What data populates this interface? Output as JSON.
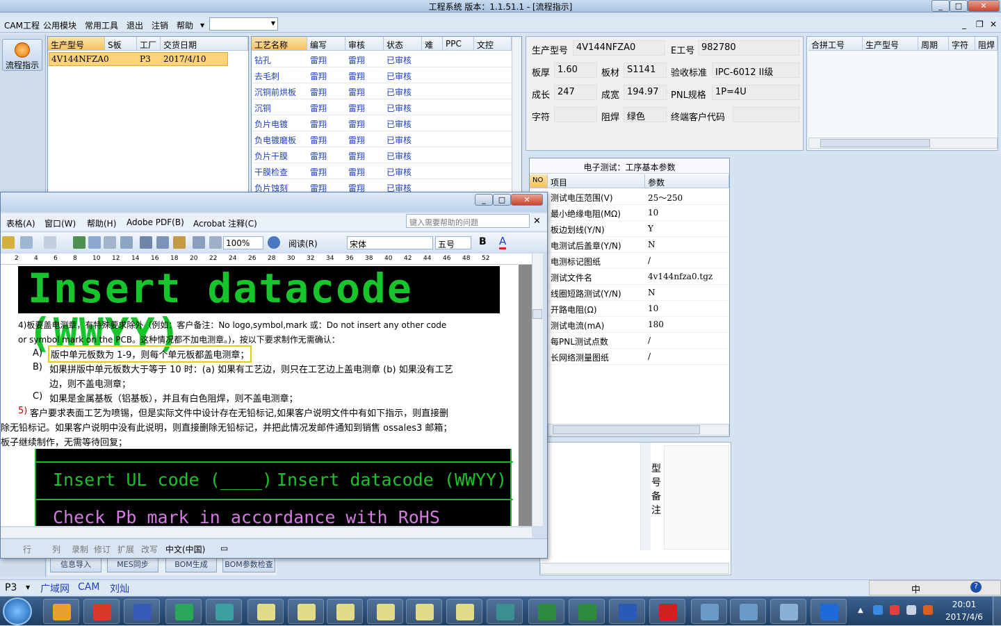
{
  "app": {
    "title": "工程系统   版本：1.1.51.1 - [流程指示]"
  },
  "menu": [
    "CAM工程",
    "公用模块",
    "常用工具",
    "退出",
    "注销",
    "帮助"
  ],
  "nav": {
    "flow_label": "流程指示"
  },
  "product_list": {
    "headers": [
      "生产型号",
      "S板",
      "工厂",
      "交货日期"
    ],
    "row": {
      "model": "4V144NFZA0",
      "factory": "P3",
      "date": "2017/4/10"
    }
  },
  "process_grid": {
    "headers": [
      "工艺名称",
      "编写",
      "审核",
      "状态",
      "难",
      "PPC",
      "文控"
    ],
    "rows": [
      [
        "钻孔",
        "雷翔",
        "雷翔",
        "已审核"
      ],
      [
        "去毛刺",
        "雷翔",
        "雷翔",
        "已审核"
      ],
      [
        "沉铜前烘板",
        "雷翔",
        "雷翔",
        "已审核"
      ],
      [
        "沉铜",
        "雷翔",
        "雷翔",
        "已审核"
      ],
      [
        "负片电镀",
        "雷翔",
        "雷翔",
        "已审核"
      ],
      [
        "负电镀磨板",
        "雷翔",
        "雷翔",
        "已审核"
      ],
      [
        "负片干膜",
        "雷翔",
        "雷翔",
        "已审核"
      ],
      [
        "干膜检查",
        "雷翔",
        "雷翔",
        "已审核"
      ],
      [
        "负片蚀刻",
        "雷翔",
        "雷翔",
        "已审核"
      ]
    ]
  },
  "info": {
    "model_label": "生产型号",
    "model": "4V144NFZA0",
    "e_label": "E工号",
    "e_no": "982780",
    "thick_label": "板厚",
    "thick": "1.60",
    "mat_label": "板材",
    "mat": "S1141",
    "std_label": "验收标准",
    "std": "IPC-6012 II级",
    "len_label": "成长",
    "len": "247",
    "wid_label": "成宽",
    "wid": "194.97",
    "pnl_label": "PNL规格",
    "pnl": "1P=4U",
    "char_label": "字符",
    "char": "",
    "mask_label": "阻焊",
    "mask": "绿色",
    "cust_label": "终端客户代码",
    "cust": ""
  },
  "combine": {
    "headers": [
      "合拼工号",
      "生产型号",
      "周期",
      "字符",
      "阻焊"
    ]
  },
  "test_params": {
    "title": "电子测试：工序基本参数",
    "headers": [
      "NO",
      "项目",
      "参数"
    ],
    "rows": [
      [
        "测试电压范围(V)",
        "25～250"
      ],
      [
        "最小绝缘电阻(MΩ)",
        "10"
      ],
      [
        "板边划线(Y/N)",
        "Y"
      ],
      [
        "电测试后盖章(Y/N)",
        "N"
      ],
      [
        "电测标记图纸",
        "/"
      ],
      [
        "测试文件名",
        "4v144nfza0.tgz"
      ],
      [
        "线圈短路测试(Y/N)",
        "N"
      ],
      [
        "开路电阻(Ω)",
        "10"
      ],
      [
        "测试电流(mA)",
        "180"
      ],
      [
        "每PNL测试点数",
        "/"
      ],
      [
        "长网络测量图纸",
        "/"
      ]
    ]
  },
  "remarks": {
    "label": "型号备注"
  },
  "bottom_buttons": [
    "信息导入",
    "MES同步",
    "BOM生成",
    "BOM参数检查"
  ],
  "status": {
    "plant": "P3",
    "tabs": [
      "广域网",
      "CAM",
      "刘灿"
    ]
  },
  "word": {
    "menu": [
      "表格(A)",
      "窗口(W)",
      "帮助(H)",
      "Adobe PDF(B)",
      "Acrobat 注释(C)"
    ],
    "help_placeholder": "键入需要帮助的问题",
    "zoom": "100%",
    "read": "阅读(R)",
    "font": "宋体",
    "size": "五号",
    "ruler": [
      "2",
      "4",
      "6",
      "8",
      "10",
      "12",
      "14",
      "16",
      "18",
      "20",
      "22",
      "24",
      "26",
      "28",
      "30",
      "32",
      "34",
      "36",
      "38",
      "40",
      "42",
      "44",
      "46",
      "48",
      "52"
    ],
    "banner1": "Insert datacode (WWYY)",
    "p4a": "4)板要盖电测章，有特殊要求除外（例如：客户备注：No logo,symbol,mark 或：Do not insert any other code",
    "p4b": "or symbol mark on the PCB。这种情况都不加电测章。)，按以下要求制作无需确认：",
    "pA_label": "A)",
    "pA": "版中单元板数为 1-9，则每个单元板都盖电测章；",
    "pB_label": "B)",
    "pB1": "如果拼版中单元板数大于等于 10 时：(a) 如果有工艺边，则只在工艺边上盖电测章 (b) 如果没有工艺",
    "pB2": "边，则不盖电测章；",
    "pC_label": "C)",
    "pC": "如果是金属基板（铝基板），并且有白色阻焊，则不盖电测章；",
    "p5_num": "5)",
    "p5a": "客户要求表面工艺为喷锡，但是实际文件中设计存在无铅标记,如果客户说明文件中有如下指示，则直接删",
    "p5b": "除无铅标记。如果客户说明中没有此说明，则直接删除无铅标记，并把此情况发邮件通知到销售 ossales3 邮箱；",
    "p5c": "板子继续制作，无需等待回复；",
    "banner2a": "Insert UL code (____)",
    "banner2b": "Insert datacode (WWYY)",
    "banner3": "Check Pb mark in accordance with RoHS finish",
    "status": [
      "行",
      "列",
      "录制",
      "修订",
      "扩展",
      "改写",
      "中文(中国)"
    ]
  },
  "tray": {
    "ime": "中",
    "time": "20:01",
    "date": "2017/4/6"
  }
}
